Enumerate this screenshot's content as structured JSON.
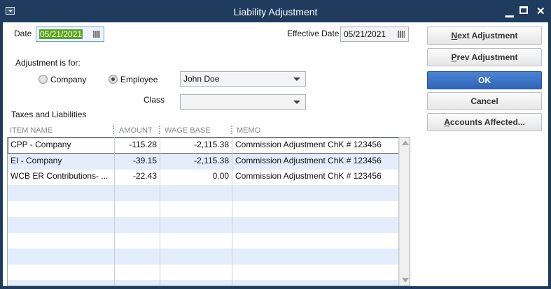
{
  "window": {
    "title": "Liability Adjustment"
  },
  "form": {
    "date_label": "Date",
    "date_value": "05/21/2021",
    "effective_date_label": "Effective Date",
    "effective_date_value": "05/21/2021",
    "adjustment_for_label": "Adjustment is for:",
    "company_label": "Company",
    "employee_label": "Employee",
    "selected": "Employee",
    "employee_value": "John Doe",
    "class_label": "Class",
    "class_value": "",
    "section_label": "Taxes and Liabilities"
  },
  "buttons": {
    "next_key": "N",
    "next_rest": "ext Adjustment",
    "prev_key": "P",
    "prev_rest": "rev Adjustment",
    "ok": "OK",
    "cancel": "Cancel",
    "accounts_key": "A",
    "accounts_rest": "ccounts Affected..."
  },
  "table": {
    "columns": [
      "ITEM NAME",
      "AMOUNT",
      "WAGE BASE",
      "MEMO"
    ],
    "rows": [
      {
        "item": "CPP - Company",
        "amount": "-115.28",
        "wage_base": "-2,115.38",
        "memo": "Commission Adjustment ChK # 123456"
      },
      {
        "item": "EI - Company",
        "amount": "-39.15",
        "wage_base": "-2,115.38",
        "memo": "Commission Adjustment ChK # 123456"
      },
      {
        "item": "WCB ER Contributions- ...",
        "amount": "-22.43",
        "wage_base": "0.00",
        "memo": "Commission Adjustment ChK # 123456"
      }
    ]
  }
}
